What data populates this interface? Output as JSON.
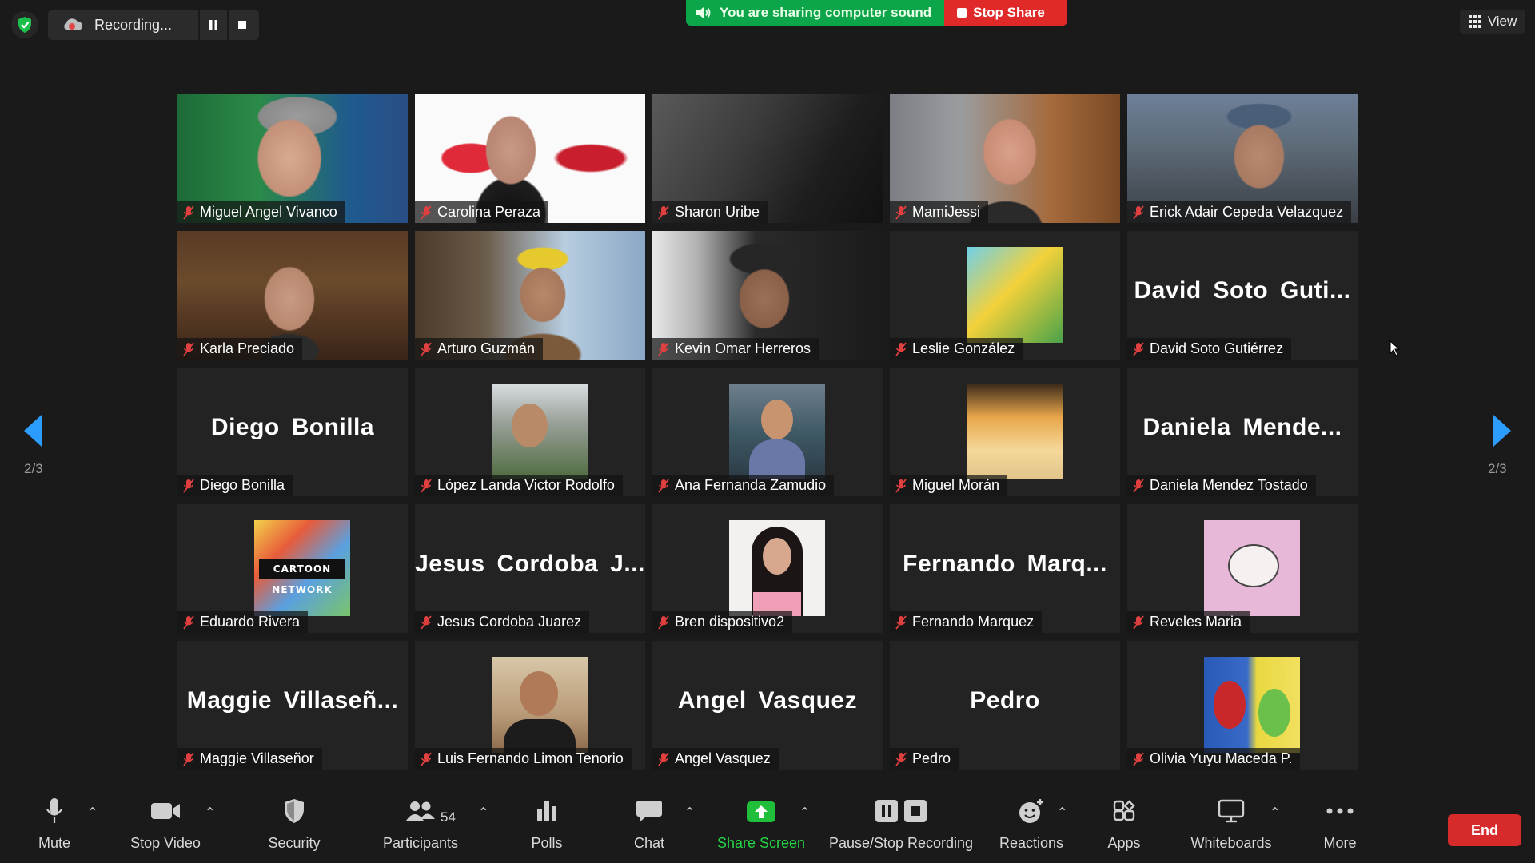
{
  "top_bar": {
    "recording_text": "Recording...",
    "sharing_sound_text": "You are sharing computer sound",
    "stop_share_label": "Stop Share",
    "view_label": "View"
  },
  "page_indicator": {
    "left": "2/3",
    "right": "2/3"
  },
  "tiles": [
    {
      "name": "Miguel Angel Vivanco"
    },
    {
      "name": "Carolina Peraza"
    },
    {
      "name": "Sharon Uribe"
    },
    {
      "name": "MamiJessi"
    },
    {
      "name": "Erick Adair Cepeda Velazquez"
    },
    {
      "name": "Karla Preciado"
    },
    {
      "name": "Arturo Guzmán"
    },
    {
      "name": "Kevin Omar Herreros"
    },
    {
      "name": "Leslie González"
    },
    {
      "name": "David Soto Gutiérrez",
      "display_name": "David Soto Guti..."
    },
    {
      "name": "Diego Bonilla",
      "display_name": "Diego Bonilla"
    },
    {
      "name": "López Landa Victor Rodolfo"
    },
    {
      "name": "Ana Fernanda Zamudio"
    },
    {
      "name": "Miguel Morán"
    },
    {
      "name": "Daniela Mendez Tostado",
      "display_name": "Daniela Mende..."
    },
    {
      "name": "Eduardo Rivera",
      "avatar_text": "CARTOON NETWORK"
    },
    {
      "name": "Jesus Cordoba Juarez",
      "display_name": "Jesus Cordoba J..."
    },
    {
      "name": "Bren dispositivo2"
    },
    {
      "name": "Fernando Marquez",
      "display_name": "Fernando Marq..."
    },
    {
      "name": "Reveles Maria"
    },
    {
      "name": "Maggie Villaseñor",
      "display_name": "Maggie Villaseñ..."
    },
    {
      "name": "Luis Fernando Limon Tenorio"
    },
    {
      "name": "Angel Vasquez",
      "display_name": "Angel Vasquez"
    },
    {
      "name": "Pedro",
      "display_name": "Pedro"
    },
    {
      "name": "Olivia Yuyu Maceda P."
    }
  ],
  "toolbar": {
    "mute": "Mute",
    "stop_video": "Stop Video",
    "security": "Security",
    "participants": "Participants",
    "participants_count": "54",
    "polls": "Polls",
    "chat": "Chat",
    "share_screen": "Share Screen",
    "pause_stop_recording": "Pause/Stop Recording",
    "reactions": "Reactions",
    "apps": "Apps",
    "whiteboards": "Whiteboards",
    "more": "More",
    "end": "End"
  },
  "colors": {
    "background": "#1a1a1a",
    "tile": "#232323",
    "sound_green": "#0ca54a",
    "stop_red": "#e02a2a",
    "share_green": "#1fbf3b",
    "share_label_green": "#25d244",
    "arrow_blue": "#2d9cff",
    "muted_red": "#e0403f"
  }
}
